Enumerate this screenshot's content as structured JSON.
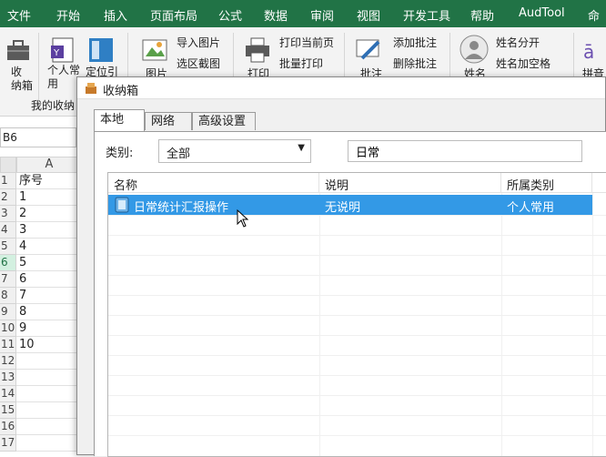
{
  "ribbon_tabs": [
    "文件",
    "开始",
    "插入",
    "页面布局",
    "公式",
    "数据",
    "审阅",
    "视图",
    "开发工具",
    "帮助",
    "AudTool",
    "命"
  ],
  "ribbon": {
    "storage_box": "收\n纳箱",
    "personal_common": "个人常\n用",
    "locate": "定位引",
    "image": "图片",
    "import_image": "导入图片",
    "select_screenshot": "选区截图",
    "print": "打印",
    "print_current_page": "打印当前页",
    "batch_print": "批量打印",
    "comment": "批注",
    "add_comment": "添加批注",
    "delete_comment": "删除批注",
    "name": "姓名",
    "name_split": "姓名分开",
    "name_add_space": "姓名加空格",
    "pinyin": "拼音",
    "group_label": "我的收纳"
  },
  "sheet": {
    "name_box": "B6",
    "column": "A",
    "rows": [
      {
        "n": "1",
        "v": "序号"
      },
      {
        "n": "2",
        "v": "1"
      },
      {
        "n": "3",
        "v": "2"
      },
      {
        "n": "4",
        "v": "3"
      },
      {
        "n": "5",
        "v": "4"
      },
      {
        "n": "6",
        "v": "5"
      },
      {
        "n": "7",
        "v": "6"
      },
      {
        "n": "8",
        "v": "7"
      },
      {
        "n": "9",
        "v": "8"
      },
      {
        "n": "10",
        "v": "9"
      },
      {
        "n": "11",
        "v": "10"
      },
      {
        "n": "12",
        "v": ""
      },
      {
        "n": "13",
        "v": ""
      },
      {
        "n": "14",
        "v": ""
      },
      {
        "n": "15",
        "v": ""
      },
      {
        "n": "16",
        "v": ""
      },
      {
        "n": "17",
        "v": ""
      }
    ],
    "active_row": "6"
  },
  "dialog": {
    "title": "收纳箱",
    "tabs": [
      "本地",
      "网络",
      "高级设置"
    ],
    "category_label": "类别:",
    "category_value": "全部",
    "search_value": "日常",
    "columns": [
      "名称",
      "说明",
      "所属类别"
    ],
    "items": [
      {
        "name": "日常统计汇报操作",
        "desc": "无说明",
        "category": "个人常用"
      }
    ]
  },
  "colors": {
    "excel_green": "#217346",
    "selection_blue": "#3399e6"
  }
}
